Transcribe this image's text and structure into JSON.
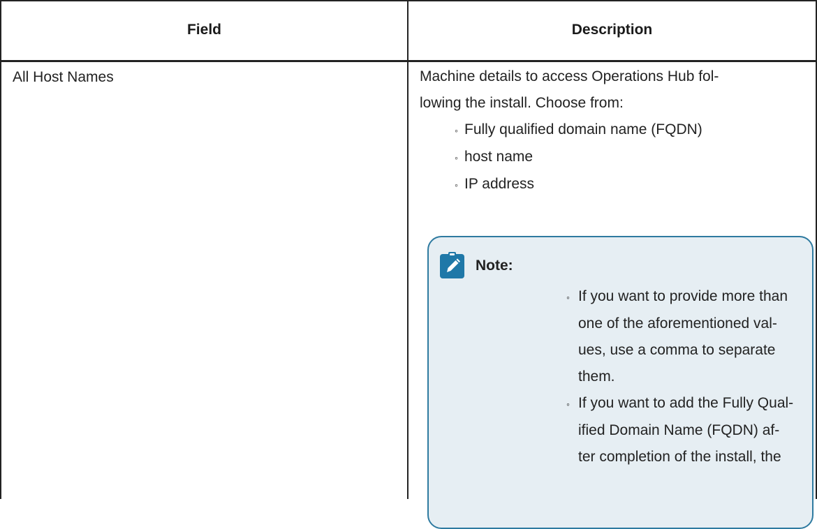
{
  "table": {
    "headers": {
      "field": "Field",
      "description": "Description"
    },
    "rows": [
      {
        "field": "All Host Names",
        "description_intro_line1": "Machine details to access Operations Hub fol-",
        "description_intro_line2": "lowing the install. Choose from:",
        "options": [
          "Fully qualified domain name (FQDN)",
          "host name",
          "IP address"
        ],
        "note": {
          "title": "Note:",
          "icon": "pencil-note-icon",
          "items": [
            [
              "If you want to provide more than",
              "one of the aforementioned val-",
              "ues, use a comma to separate",
              "them."
            ],
            [
              "If you want to add the Fully Qual-",
              "ified Domain Name (FQDN) af-",
              "ter completion of the install, the"
            ]
          ]
        }
      }
    ]
  },
  "colors": {
    "border": "#222222",
    "note_background": "#e6eef3",
    "note_border": "#2e7aa0",
    "note_icon": "#1f78a8"
  }
}
